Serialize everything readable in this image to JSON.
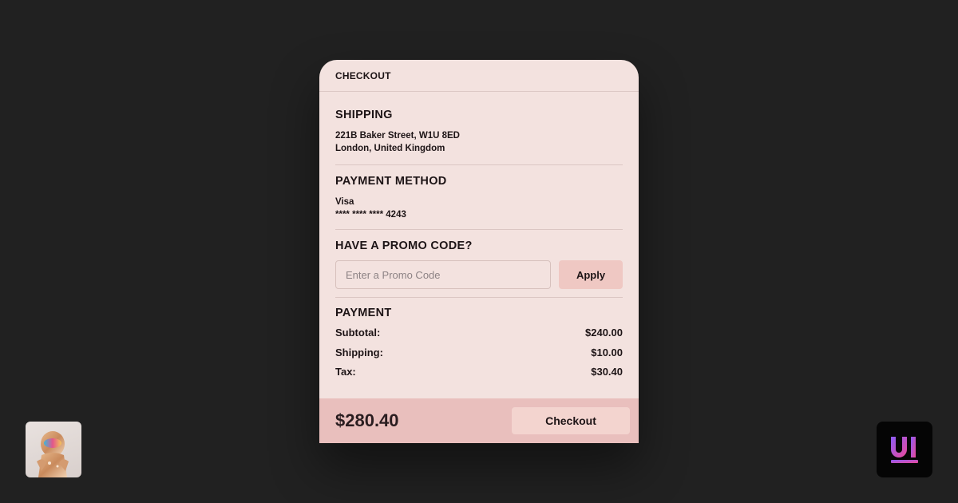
{
  "header": {
    "title": "CHECKOUT"
  },
  "shipping": {
    "heading": "SHIPPING",
    "address_line1": "221B Baker Street, W1U 8ED",
    "address_line2": "London, United Kingdom"
  },
  "payment_method": {
    "heading": "PAYMENT METHOD",
    "card_type": "Visa",
    "card_number": "**** **** **** 4243"
  },
  "promo": {
    "heading": "HAVE A PROMO CODE?",
    "placeholder": "Enter a Promo Code",
    "value": "",
    "apply_label": "Apply"
  },
  "payment": {
    "heading": "PAYMENT",
    "rows": [
      {
        "label": "Subtotal:",
        "value": "$240.00"
      },
      {
        "label": "Shipping:",
        "value": "$10.00"
      },
      {
        "label": "Tax:",
        "value": "$30.40"
      }
    ]
  },
  "footer": {
    "total": "$280.40",
    "checkout_label": "Checkout"
  },
  "colors": {
    "page_background": "#212121",
    "card_background": "#f3e2df",
    "footer_background": "#e9bfbd",
    "button_background": "#efc8c3",
    "logo_gradient_start": "#8b5cf6",
    "logo_gradient_end": "#ec4899"
  },
  "icons": {
    "avatar": "astronaut-avatar-image",
    "logo": "ui-logo-icon"
  }
}
